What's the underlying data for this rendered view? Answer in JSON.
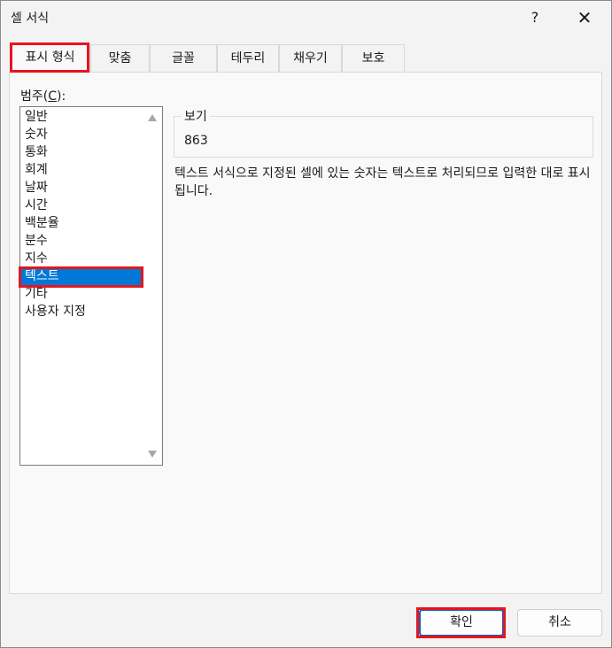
{
  "window": {
    "title": "셀 서식",
    "help_label": "?",
    "close_label": "✕"
  },
  "tabs": [
    {
      "label": "표시 형식",
      "active": true
    },
    {
      "label": "맞춤"
    },
    {
      "label": "글꼴"
    },
    {
      "label": "테두리"
    },
    {
      "label": "채우기"
    },
    {
      "label": "보호"
    }
  ],
  "category": {
    "label_prefix": "범주(",
    "label_accel": "C",
    "label_suffix": "):",
    "items": [
      "일반",
      "숫자",
      "통화",
      "회계",
      "날짜",
      "시간",
      "백분율",
      "분수",
      "지수",
      "텍스트",
      "기타",
      "사용자 지정"
    ],
    "selected": "텍스트"
  },
  "sample": {
    "legend": "보기",
    "value": "863"
  },
  "description": "텍스트 서식으로 지정된 셀에 있는 숫자는 텍스트로 처리되므로 입력한 대로 표시됩니다.",
  "buttons": {
    "ok": "확인",
    "cancel": "취소"
  },
  "colors": {
    "highlight": "#e8141c",
    "selection": "#0078d7"
  },
  "icons": {
    "close": "close-icon",
    "help": "help-icon",
    "scroll_up": "scroll-up-arrow-icon",
    "scroll_down": "scroll-down-arrow-icon"
  }
}
